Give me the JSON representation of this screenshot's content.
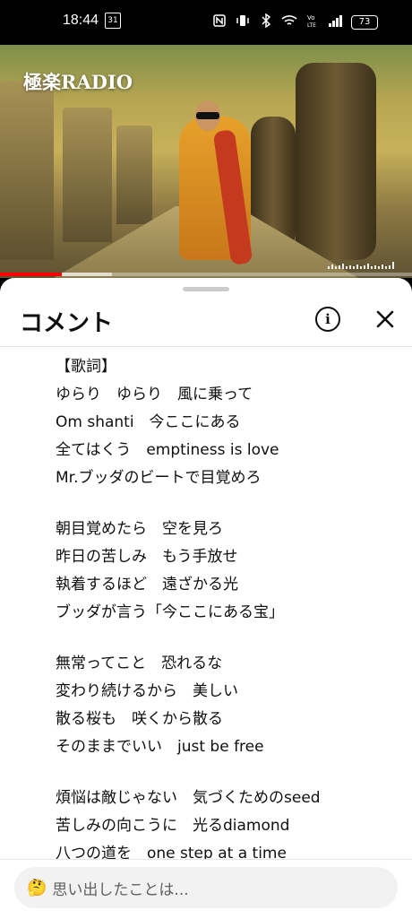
{
  "status_bar": {
    "time": "18:44",
    "calendar_day": "31",
    "battery": "73"
  },
  "video": {
    "channel_logo": "極楽RADIO",
    "progress_fraction": 0.15
  },
  "sheet": {
    "title": "コメント",
    "info_icon": "info-icon",
    "close_icon": "close-icon",
    "lyrics": [
      "【歌詞】",
      "ゆらり　ゆらり　風に乗って",
      "Om shanti　今ここにある",
      "全てはくう　emptiness is love",
      "Mr.ブッダのビートで目覚めろ",
      "",
      "朝目覚めたら　空を見ろ",
      "昨日の苦しみ　もう手放せ",
      "執着するほど　遠ざかる光",
      "ブッダが言う「今ここにある宝」",
      "",
      "無常ってこと　恐れるな",
      "変わり続けるから　美しい",
      "散る桜も　咲くから散る",
      "そのままでいい　just be free",
      "",
      "煩悩は敵じゃない　気づくためのseed",
      "苦しみの向こうに　光るdiamond",
      "八つの道を　one step at a time"
    ]
  },
  "comment_input": {
    "emoji": "🤔",
    "placeholder": "思い出したことは..."
  }
}
